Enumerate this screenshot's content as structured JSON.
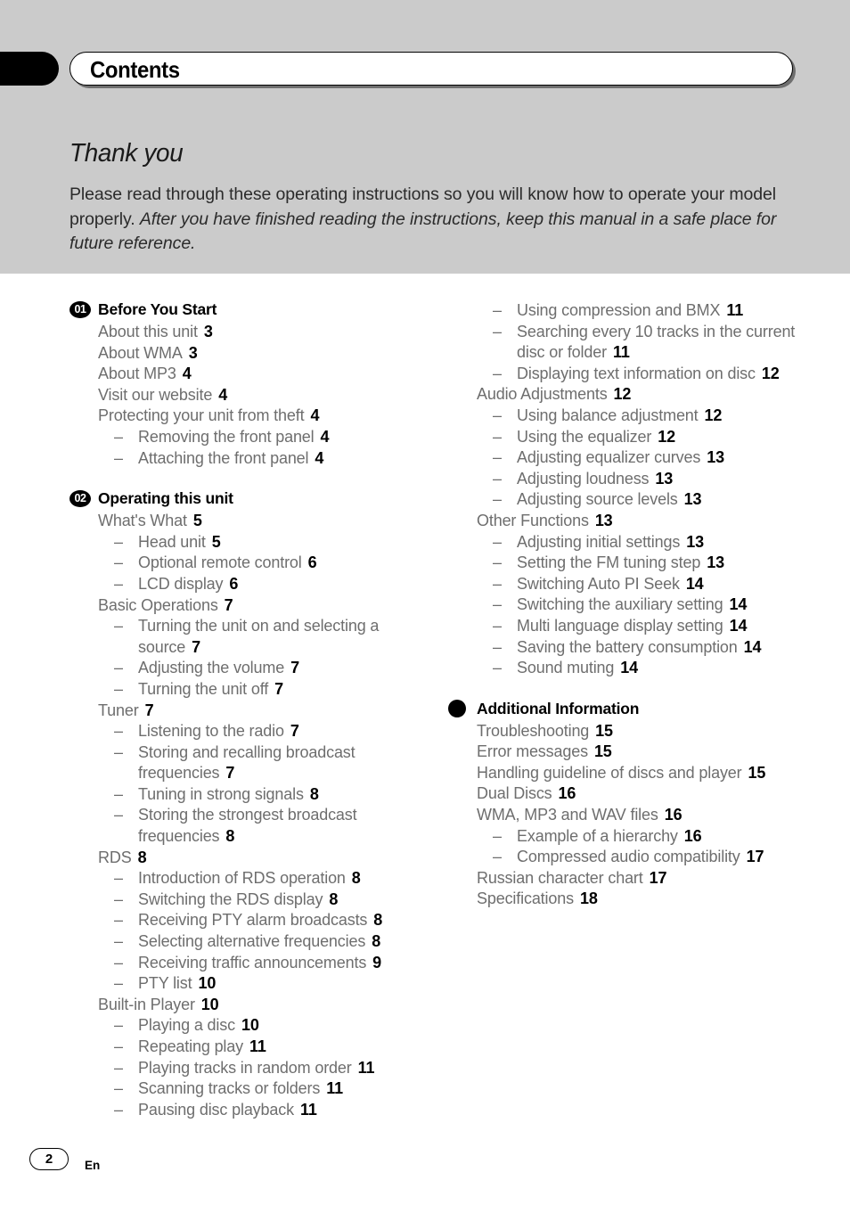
{
  "header": {
    "title": "Contents",
    "tab_icon": "black-tab-marker"
  },
  "intro": {
    "heading": "Thank you",
    "body_plain": "Please read through these operating instructions so you will know how to operate your model properly. ",
    "body_italic": "After you have finished reading the instructions, keep this manual in a safe place for future reference."
  },
  "footer": {
    "page_number": "2",
    "language": "En"
  },
  "colors": {
    "band_gray": "#cbcbcb",
    "entry_gray": "#6e6e6e",
    "page_black": "#000000",
    "body_text": "#2b2b2b"
  },
  "columns": [
    {
      "name": "left-column",
      "sections": [
        {
          "badge": "01",
          "badge_style": "number",
          "title": "Before You Start",
          "entries": [
            {
              "level": 1,
              "label": "About this unit",
              "page": "3"
            },
            {
              "level": 1,
              "label": "About WMA",
              "page": "3"
            },
            {
              "level": 1,
              "label": "About MP3",
              "page": "4"
            },
            {
              "level": 1,
              "label": "Visit our website",
              "page": "4"
            },
            {
              "level": 1,
              "label": "Protecting your unit from theft",
              "page": "4"
            },
            {
              "level": 2,
              "label": "Removing the front panel",
              "page": "4"
            },
            {
              "level": 2,
              "label": "Attaching the front panel",
              "page": "4"
            }
          ]
        },
        {
          "badge": "02",
          "badge_style": "number",
          "title": "Operating this unit",
          "entries": [
            {
              "level": 1,
              "label": "What's What",
              "page": "5"
            },
            {
              "level": 2,
              "label": "Head unit",
              "page": "5"
            },
            {
              "level": 2,
              "label": "Optional remote control",
              "page": "6"
            },
            {
              "level": 2,
              "label": "LCD display",
              "page": "6"
            },
            {
              "level": 1,
              "label": "Basic Operations",
              "page": "7"
            },
            {
              "level": 2,
              "label": "Turning the unit on and selecting a source",
              "page": "7"
            },
            {
              "level": 2,
              "label": "Adjusting the volume",
              "page": "7"
            },
            {
              "level": 2,
              "label": "Turning the unit off",
              "page": "7"
            },
            {
              "level": 1,
              "label": "Tuner",
              "page": "7"
            },
            {
              "level": 2,
              "label": "Listening to the radio",
              "page": "7"
            },
            {
              "level": 2,
              "label": "Storing and recalling broadcast frequencies",
              "page": "7"
            },
            {
              "level": 2,
              "label": "Tuning in strong signals",
              "page": "8"
            },
            {
              "level": 2,
              "label": "Storing the strongest broadcast frequencies",
              "page": "8"
            },
            {
              "level": 1,
              "label": "RDS",
              "page": "8"
            },
            {
              "level": 2,
              "label": "Introduction of RDS operation",
              "page": "8"
            },
            {
              "level": 2,
              "label": "Switching the RDS display",
              "page": "8"
            },
            {
              "level": 2,
              "label": "Receiving PTY alarm broadcasts",
              "page": "8"
            },
            {
              "level": 2,
              "label": "Selecting alternative frequencies",
              "page": "8"
            },
            {
              "level": 2,
              "label": "Receiving traffic announcements",
              "page": "9"
            },
            {
              "level": 2,
              "label": "PTY list",
              "page": "10"
            },
            {
              "level": 1,
              "label": "Built-in Player",
              "page": "10"
            },
            {
              "level": 2,
              "label": "Playing a disc",
              "page": "10"
            },
            {
              "level": 2,
              "label": "Repeating play",
              "page": "11"
            },
            {
              "level": 2,
              "label": "Playing tracks in random order",
              "page": "11"
            },
            {
              "level": 2,
              "label": "Scanning tracks or folders",
              "page": "11"
            },
            {
              "level": 2,
              "label": "Pausing disc playback",
              "page": "11"
            }
          ]
        }
      ]
    },
    {
      "name": "right-column",
      "sections": [
        {
          "badge": "",
          "badge_style": "continuation",
          "title": "",
          "entries": [
            {
              "level": 2,
              "label": "Using compression and BMX",
              "page": "11"
            },
            {
              "level": 2,
              "label": "Searching every 10 tracks in the current disc or folder",
              "page": "11"
            },
            {
              "level": 2,
              "label": "Displaying text information on disc",
              "page": "12"
            },
            {
              "level": 1,
              "label": "Audio Adjustments",
              "page": "12"
            },
            {
              "level": 2,
              "label": "Using balance adjustment",
              "page": "12"
            },
            {
              "level": 2,
              "label": "Using the equalizer",
              "page": "12"
            },
            {
              "level": 2,
              "label": "Adjusting equalizer curves",
              "page": "13"
            },
            {
              "level": 2,
              "label": "Adjusting loudness",
              "page": "13"
            },
            {
              "level": 2,
              "label": "Adjusting source levels",
              "page": "13"
            },
            {
              "level": 1,
              "label": "Other Functions",
              "page": "13"
            },
            {
              "level": 2,
              "label": "Adjusting initial settings",
              "page": "13"
            },
            {
              "level": 2,
              "label": "Setting the FM tuning step",
              "page": "13"
            },
            {
              "level": 2,
              "label": "Switching Auto PI Seek",
              "page": "14"
            },
            {
              "level": 2,
              "label": "Switching the auxiliary setting",
              "page": "14"
            },
            {
              "level": 2,
              "label": "Multi language display setting",
              "page": "14"
            },
            {
              "level": 2,
              "label": "Saving the battery consumption",
              "page": "14"
            },
            {
              "level": 2,
              "label": "Sound muting",
              "page": "14"
            }
          ]
        },
        {
          "badge": "",
          "badge_style": "solid",
          "title": "Additional Information",
          "entries": [
            {
              "level": 1,
              "label": "Troubleshooting",
              "page": "15"
            },
            {
              "level": 1,
              "label": "Error messages",
              "page": "15"
            },
            {
              "level": 1,
              "label": "Handling guideline of discs and player",
              "page": "15"
            },
            {
              "level": 1,
              "label": "Dual Discs",
              "page": "16"
            },
            {
              "level": 1,
              "label": "WMA, MP3 and WAV files",
              "page": "16"
            },
            {
              "level": 2,
              "label": "Example of a hierarchy",
              "page": "16"
            },
            {
              "level": 2,
              "label": "Compressed audio compatibility",
              "page": "17"
            },
            {
              "level": 1,
              "label": "Russian character chart",
              "page": "17"
            },
            {
              "level": 1,
              "label": "Specifications",
              "page": "18"
            }
          ]
        }
      ]
    }
  ]
}
